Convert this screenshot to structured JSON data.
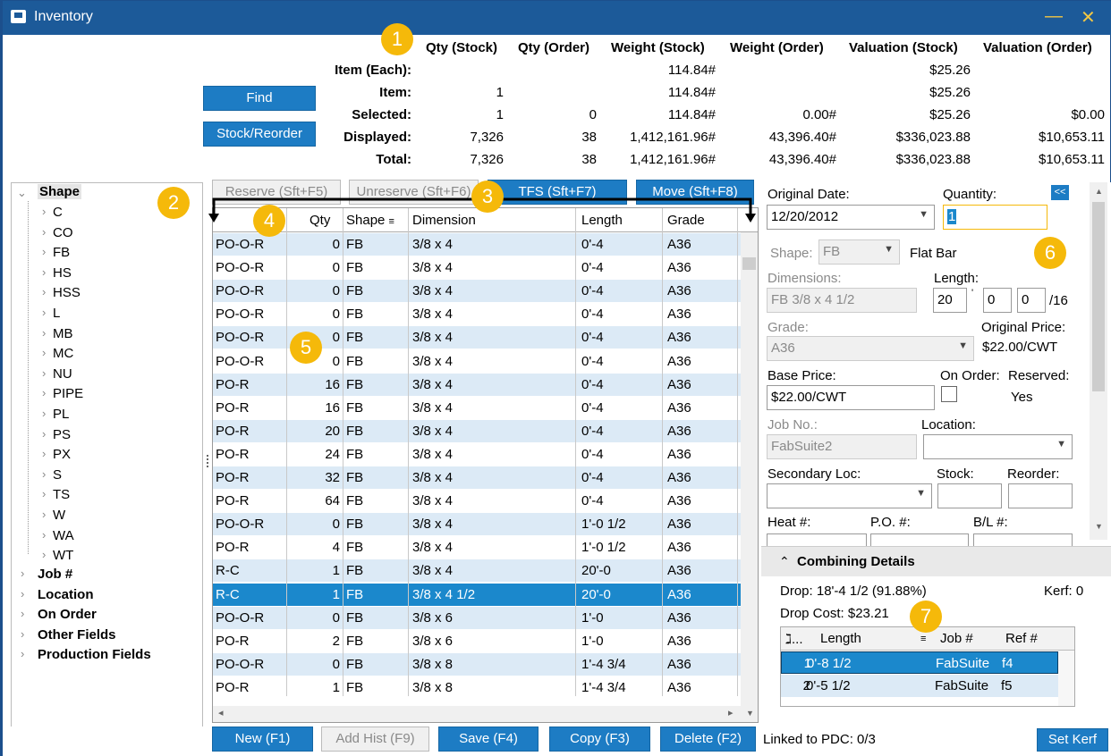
{
  "window": {
    "title": "Inventory",
    "minimize": "—",
    "close": "✕"
  },
  "summary": {
    "headers": [
      "Qty (Stock)",
      "Qty (Order)",
      "Weight (Stock)",
      "Weight (Order)",
      "Valuation (Stock)",
      "Valuation (Order)"
    ],
    "rows": [
      {
        "label": "Item (Each):",
        "values": [
          "",
          "",
          "114.84#",
          "",
          "$25.26",
          ""
        ]
      },
      {
        "label": "Item:",
        "values": [
          "1",
          "",
          "114.84#",
          "",
          "$25.26",
          ""
        ]
      },
      {
        "label": "Selected:",
        "values": [
          "1",
          "0",
          "114.84#",
          "0.00#",
          "$25.26",
          "$0.00"
        ]
      },
      {
        "label": "Displayed:",
        "values": [
          "7,326",
          "38",
          "1,412,161.96#",
          "43,396.40#",
          "$336,023.88",
          "$10,653.11"
        ]
      },
      {
        "label": "Total:",
        "values": [
          "7,326",
          "38",
          "1,412,161.96#",
          "43,396.40#",
          "$336,023.88",
          "$10,653.11"
        ]
      }
    ],
    "find_label": "Find",
    "stock_reorder_label": "Stock/Reorder"
  },
  "badges": [
    "1",
    "2",
    "3",
    "4",
    "5",
    "6",
    "7"
  ],
  "tree": {
    "root": "Shape",
    "children": [
      "C",
      "CO",
      "FB",
      "HS",
      "HSS",
      "L",
      "MB",
      "MC",
      "NU",
      "PIPE",
      "PL",
      "PS",
      "PX",
      "S",
      "TS",
      "W",
      "WA",
      "WT"
    ],
    "groups": [
      "Job #",
      "Location",
      "On Order",
      "Other Fields",
      "Production Fields"
    ]
  },
  "actions": {
    "reserve": "Reserve (Sft+F5)",
    "unreserve": "Unreserve (Sft+F6)",
    "tfs": "TFS (Sft+F7)",
    "move": "Move (Sft+F8)"
  },
  "grid": {
    "columns": [
      "Qty",
      "Shape",
      "Dimension",
      "Length",
      "Grade"
    ],
    "rows": [
      [
        "PO-O-R",
        "0",
        "FB",
        "3/8 x 4",
        "0'-4",
        "A36"
      ],
      [
        "PO-O-R",
        "0",
        "FB",
        "3/8 x 4",
        "0'-4",
        "A36"
      ],
      [
        "PO-O-R",
        "0",
        "FB",
        "3/8 x 4",
        "0'-4",
        "A36"
      ],
      [
        "PO-O-R",
        "0",
        "FB",
        "3/8 x 4",
        "0'-4",
        "A36"
      ],
      [
        "PO-O-R",
        "0",
        "FB",
        "3/8 x 4",
        "0'-4",
        "A36"
      ],
      [
        "PO-O-R",
        "0",
        "FB",
        "3/8 x 4",
        "0'-4",
        "A36"
      ],
      [
        "PO-R",
        "16",
        "FB",
        "3/8 x 4",
        "0'-4",
        "A36"
      ],
      [
        "PO-R",
        "16",
        "FB",
        "3/8 x 4",
        "0'-4",
        "A36"
      ],
      [
        "PO-R",
        "20",
        "FB",
        "3/8 x 4",
        "0'-4",
        "A36"
      ],
      [
        "PO-R",
        "24",
        "FB",
        "3/8 x 4",
        "0'-4",
        "A36"
      ],
      [
        "PO-R",
        "32",
        "FB",
        "3/8 x 4",
        "0'-4",
        "A36"
      ],
      [
        "PO-R",
        "64",
        "FB",
        "3/8 x 4",
        "0'-4",
        "A36"
      ],
      [
        "PO-O-R",
        "0",
        "FB",
        "3/8 x 4",
        "1'-0 1/2",
        "A36"
      ],
      [
        "PO-R",
        "4",
        "FB",
        "3/8 x 4",
        "1'-0 1/2",
        "A36"
      ],
      [
        "R-C",
        "1",
        "FB",
        "3/8 x 4",
        "20'-0",
        "A36"
      ],
      [
        "R-C",
        "1",
        "FB",
        "3/8 x 4 1/2",
        "20'-0",
        "A36"
      ],
      [
        "PO-O-R",
        "0",
        "FB",
        "3/8 x 6",
        "1'-0",
        "A36"
      ],
      [
        "PO-R",
        "2",
        "FB",
        "3/8 x 6",
        "1'-0",
        "A36"
      ],
      [
        "PO-O-R",
        "0",
        "FB",
        "3/8 x 8",
        "1'-4 3/4",
        "A36"
      ],
      [
        "PO-R",
        "1",
        "FB",
        "3/8 x 8",
        "1'-4 3/4",
        "A36"
      ]
    ],
    "selected_row": 15
  },
  "detail": {
    "original_date_label": "Original Date:",
    "original_date": "12/20/2012",
    "quantity_label": "Quantity:",
    "quantity": "1",
    "collapse_label": "<<",
    "shape_label": "Shape:",
    "shape": "FB",
    "shape_name": "Flat Bar",
    "dimensions_label": "Dimensions:",
    "dimensions": "FB 3/8 x 4 1/2",
    "length_label": "Length:",
    "length_ft": "20",
    "length_in": "0",
    "length_frac": "0",
    "length_denom": "/16",
    "grade_label": "Grade:",
    "grade": "A36",
    "original_price_label": "Original Price:",
    "original_price": "$22.00/CWT",
    "base_price_label": "Base Price:",
    "base_price": "$22.00/CWT",
    "on_order_label": "On Order:",
    "reserved_label": "Reserved:",
    "reserved": "Yes",
    "job_no_label": "Job No.:",
    "job_no": "FabSuite2",
    "location_label": "Location:",
    "secondary_loc_label": "Secondary Loc:",
    "stock_label": "Stock:",
    "reorder_label": "Reorder:",
    "heat_label": "Heat #:",
    "po_label": "P.O. #:",
    "bl_label": "B/L #:"
  },
  "combining": {
    "title": "Combining Details",
    "drop_label": "Drop:",
    "drop": "18'-4 1/2 (91.88%)",
    "kerf_label": "Kerf:",
    "kerf": "0",
    "drop_cost_label": "Drop Cost:",
    "drop_cost": "$23.21",
    "columns": [
      "ℷ...",
      "Length",
      "Job #",
      "Ref #"
    ],
    "rows": [
      [
        "1",
        "0'-8 1/2",
        "FabSuite",
        "f4"
      ],
      [
        "2",
        "0'-5 1/2",
        "FabSuite",
        "f5"
      ]
    ]
  },
  "footer": {
    "new": "New (F1)",
    "add_hist": "Add Hist (F9)",
    "save": "Save (F4)",
    "copy": "Copy (F3)",
    "delete": "Delete (F2)",
    "linked": "Linked to PDC: 0/3",
    "set_kerf": "Set Kerf"
  },
  "colors": {
    "accent": "#1d7cc4",
    "titlebar": "#1c5a99",
    "badge": "#f5b90a",
    "row_alt": "#dceaf6",
    "row_selected": "#1b88cc"
  }
}
